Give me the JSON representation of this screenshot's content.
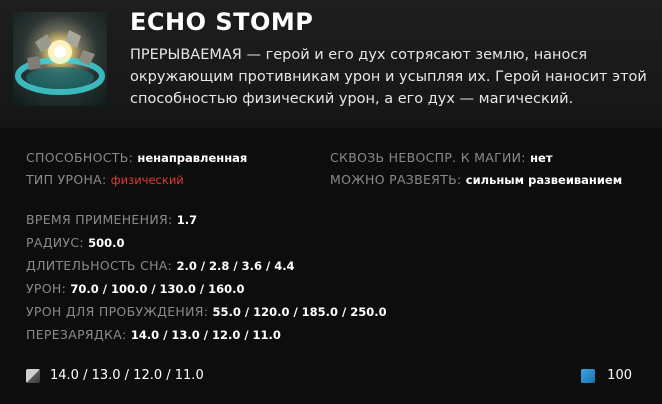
{
  "ability": {
    "name": "ECHO STOMP",
    "description": "ПРЕРЫВАЕМАЯ — герой и его дух сотрясают землю, нанося окружающим противникам урон и усыпляя их. Герой наносит этой способностью физический урон, а его дух — магический.",
    "icon": "echo-stomp-icon"
  },
  "properties_left": [
    {
      "label": "СПОСОБНОСТЬ:",
      "value": "ненаправленная"
    },
    {
      "label": "ТИП УРОНА:",
      "value": "физический"
    }
  ],
  "properties_right": [
    {
      "label": "СКВОЗЬ НЕВОСПР. К МАГИИ:",
      "value": "нет"
    },
    {
      "label": "МОЖНО РАЗВЕЯТЬ:",
      "value": "сильным развеиванием"
    }
  ],
  "stats": [
    {
      "label": "ВРЕМЯ ПРИМЕНЕНИЯ:",
      "value": "1.7"
    },
    {
      "label": "РАДИУС:",
      "value": "500.0"
    },
    {
      "label": "ДЛИТЕЛЬНОСТЬ СНА:",
      "value": "2.0 / 2.8 / 3.6 / 4.4"
    },
    {
      "label": "УРОН:",
      "value": "70.0 / 100.0 / 130.0 / 160.0"
    },
    {
      "label": "УРОН ДЛЯ ПРОБУЖДЕНИЯ:",
      "value": "55.0 / 120.0 / 185.0 / 250.0"
    },
    {
      "label": "ПЕРЕЗАРЯДКА:",
      "value": "14.0 / 13.0 / 12.0 / 11.0"
    }
  ],
  "footer": {
    "cooldown": "14.0 / 13.0 / 12.0 / 11.0",
    "cooldown_icon": "cooldown-icon",
    "mana": "100",
    "mana_icon": "mana-icon"
  },
  "colors": {
    "damage_type": "#e23b2f",
    "mana": "#2a8fd0",
    "background": "#0d0d0d"
  }
}
